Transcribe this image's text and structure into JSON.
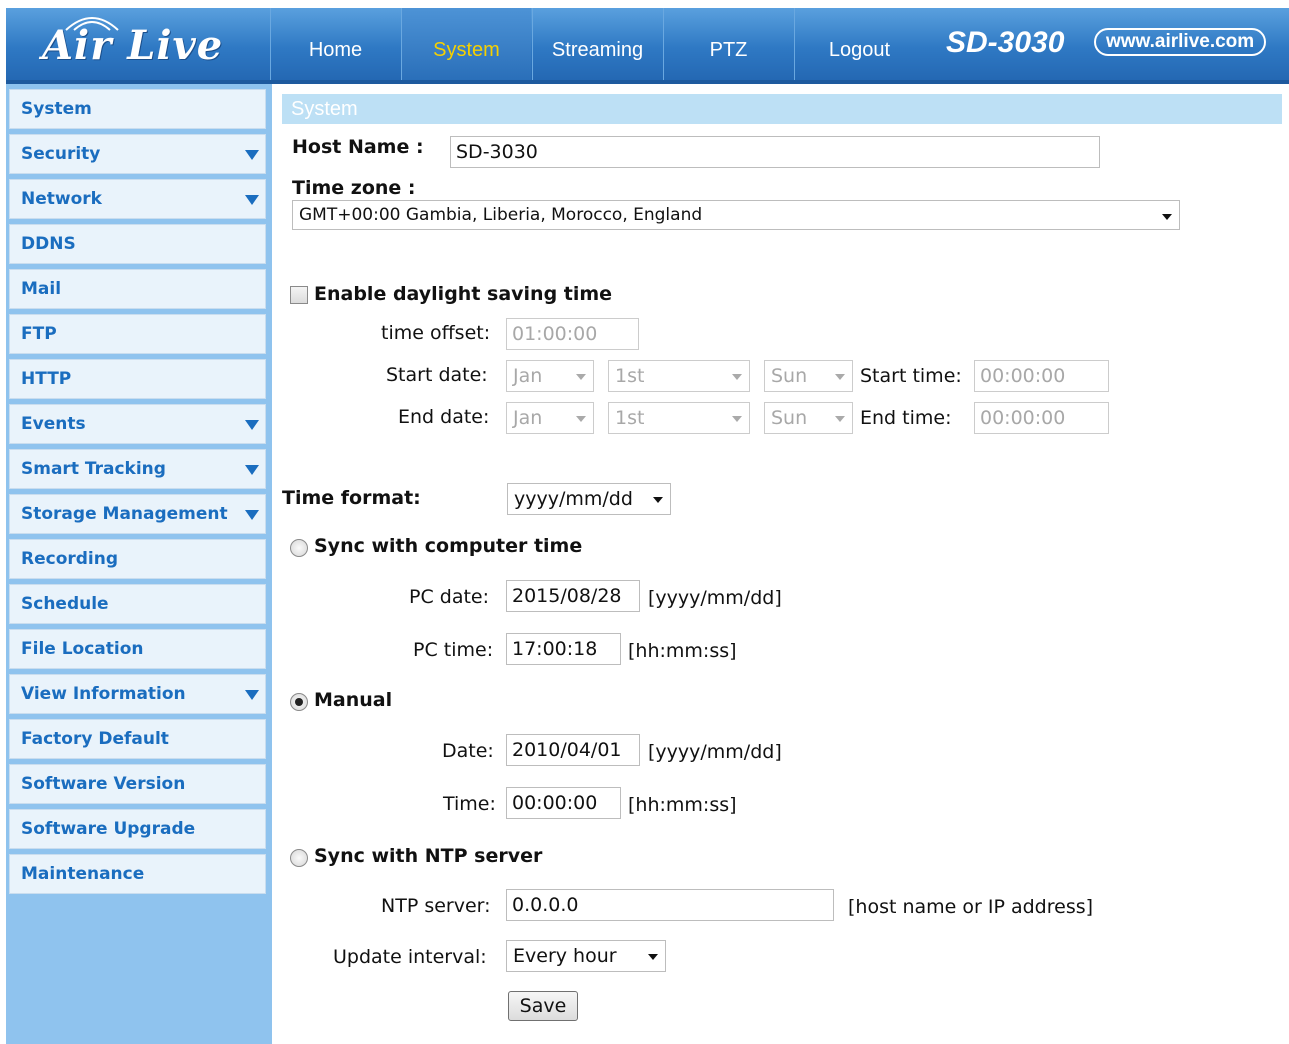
{
  "brand": {
    "logo": "Air Live",
    "model": "SD-3030",
    "url": "www.airlive.com"
  },
  "nav": {
    "home": "Home",
    "system": "System",
    "streaming": "Streaming",
    "ptz": "PTZ",
    "logout": "Logout"
  },
  "sidebar": {
    "items": [
      {
        "label": "System",
        "expandable": false
      },
      {
        "label": "Security",
        "expandable": true
      },
      {
        "label": "Network",
        "expandable": true
      },
      {
        "label": "DDNS",
        "expandable": false
      },
      {
        "label": "Mail",
        "expandable": false
      },
      {
        "label": "FTP",
        "expandable": false
      },
      {
        "label": "HTTP",
        "expandable": false
      },
      {
        "label": "Events",
        "expandable": true
      },
      {
        "label": "Smart Tracking",
        "expandable": true
      },
      {
        "label": "Storage Management",
        "expandable": true
      },
      {
        "label": "Recording",
        "expandable": false
      },
      {
        "label": "Schedule",
        "expandable": false
      },
      {
        "label": "File Location",
        "expandable": false
      },
      {
        "label": "View Information",
        "expandable": true
      },
      {
        "label": "Factory Default",
        "expandable": false
      },
      {
        "label": "Software Version",
        "expandable": false
      },
      {
        "label": "Software Upgrade",
        "expandable": false
      },
      {
        "label": "Maintenance",
        "expandable": false
      }
    ]
  },
  "main": {
    "section_title": "System",
    "host_name_label": "Host Name :",
    "host_name_value": "SD-3030",
    "time_zone_label": "Time zone :",
    "time_zone_value": "GMT+00:00 Gambia, Liberia, Morocco, England",
    "dst": {
      "label": "Enable daylight saving time",
      "checked": false,
      "time_offset_label": "time offset:",
      "time_offset_value": "01:00:00",
      "start_date_label": "Start date:",
      "start_month": "Jan",
      "start_day": "1st",
      "start_weekday": "Sun",
      "start_time_label": "Start time:",
      "start_time_value": "00:00:00",
      "end_date_label": "End date:",
      "end_month": "Jan",
      "end_day": "1st",
      "end_weekday": "Sun",
      "end_time_label": "End time:",
      "end_time_value": "00:00:00"
    },
    "time_format_label": "Time format:",
    "time_format_value": "yyyy/mm/dd",
    "sync_pc": {
      "label": "Sync with computer time",
      "selected": false,
      "pc_date_label": "PC date:",
      "pc_date_value": "2015/08/28",
      "pc_date_hint": "[yyyy/mm/dd]",
      "pc_time_label": "PC time:",
      "pc_time_value": "17:00:18",
      "pc_time_hint": "[hh:mm:ss]"
    },
    "manual": {
      "label": "Manual",
      "selected": true,
      "date_label": "Date:",
      "date_value": "2010/04/01",
      "date_hint": "[yyyy/mm/dd]",
      "time_label": "Time:",
      "time_value": "00:00:00",
      "time_hint": "[hh:mm:ss]"
    },
    "ntp": {
      "label": "Sync with NTP server",
      "selected": false,
      "server_label": "NTP server:",
      "server_value": "0.0.0.0",
      "server_hint": "[host name or IP address]",
      "interval_label": "Update interval:",
      "interval_value": "Every hour"
    },
    "save_label": "Save"
  }
}
